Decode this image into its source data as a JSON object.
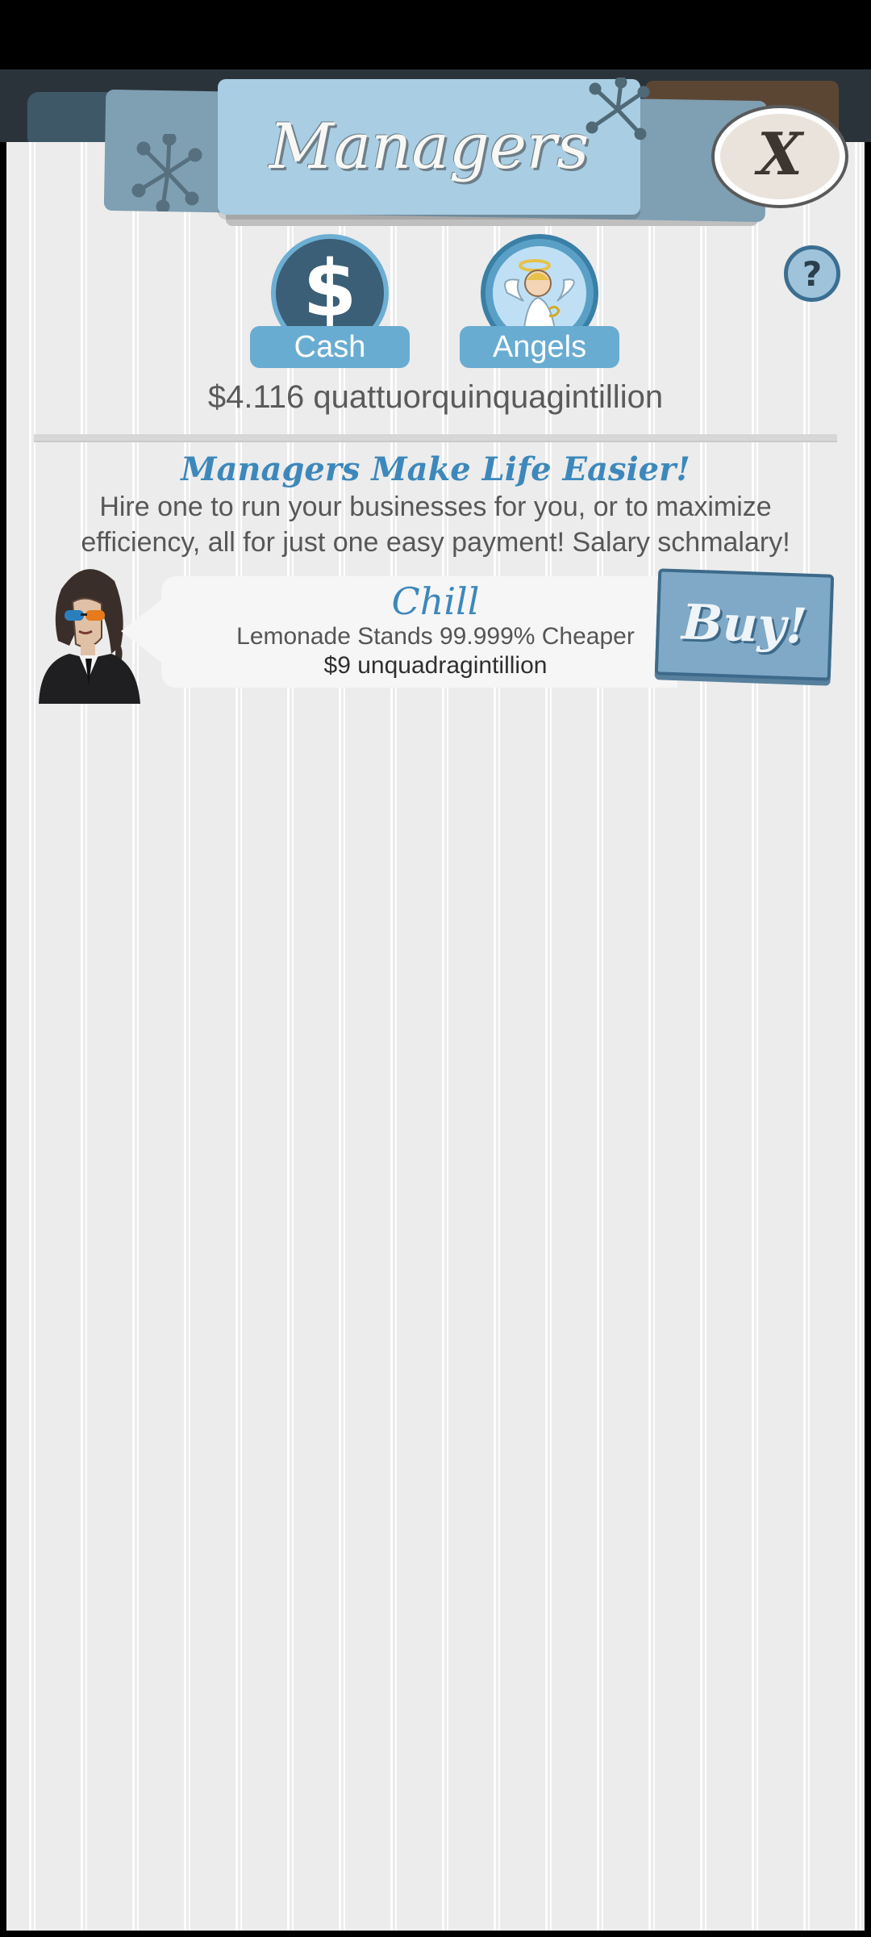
{
  "header": {
    "title": "Managers",
    "close_label": "X",
    "help_label": "?"
  },
  "tabs": [
    {
      "id": "cash",
      "label": "Cash",
      "icon": "dollar-icon",
      "glyph": "$"
    },
    {
      "id": "angels",
      "label": "Angels",
      "icon": "angel-icon"
    }
  ],
  "cash_amount": "$4.116 quattuorquinquagintillion",
  "intro": {
    "headline": "Managers Make Life Easier!",
    "description": "Hire one to run your businesses for you, or to maximize efficiency, all for just one easy payment! Salary schmalary!"
  },
  "managers": [
    {
      "name": "Chill",
      "effect": "Lemonade Stands 99.999% Cheaper",
      "cost": "$9 unquadragintillion",
      "buy_label": "Buy!"
    }
  ],
  "colors": {
    "accent_blue": "#3d88bb",
    "button_blue": "#7fa9c6",
    "panel_bg": "#ececec"
  }
}
